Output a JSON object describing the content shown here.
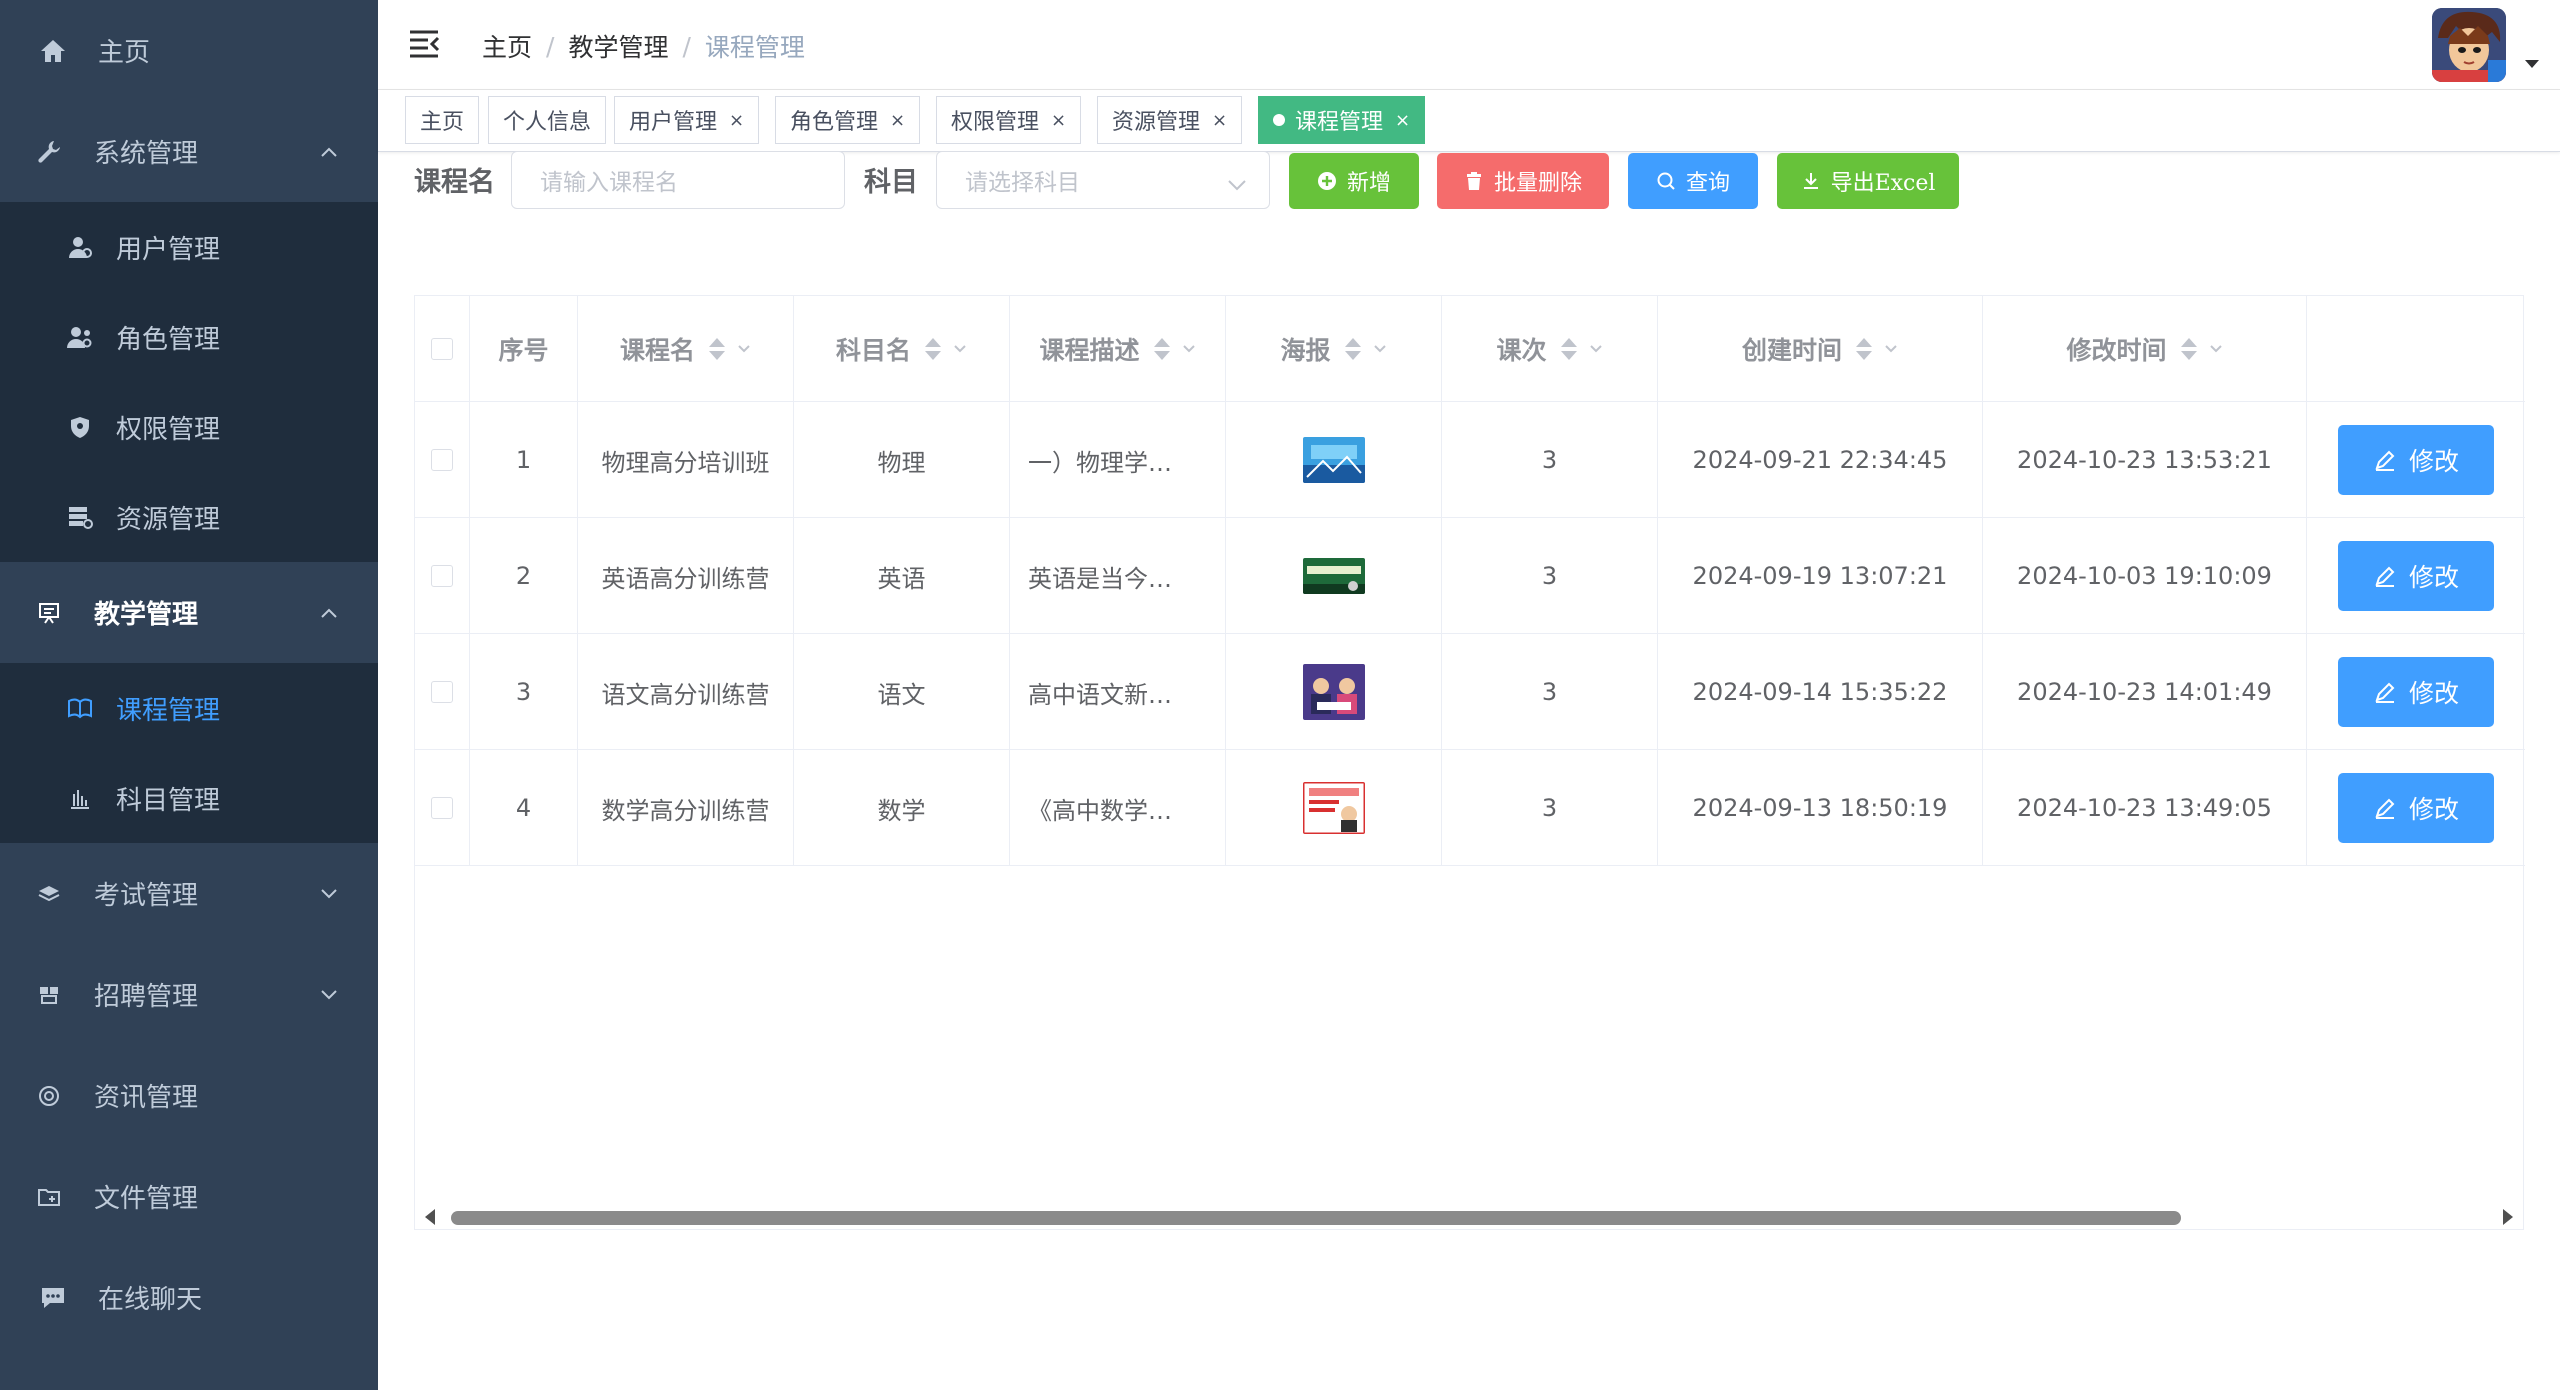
{
  "sidebar": {
    "items": [
      {
        "label": "主页",
        "icon": "home-icon"
      },
      {
        "label": "系统管理",
        "icon": "wrench-icon",
        "expanded": true
      },
      {
        "label": "教学管理",
        "icon": "teaching-icon",
        "expanded": true
      },
      {
        "label": "考试管理",
        "icon": "exam-icon",
        "expanded": false
      },
      {
        "label": "招聘管理",
        "icon": "recruit-icon",
        "expanded": false
      },
      {
        "label": "资讯管理",
        "icon": "news-icon"
      },
      {
        "label": "文件管理",
        "icon": "folder-icon"
      },
      {
        "label": "在线聊天",
        "icon": "chat-icon"
      }
    ],
    "system_sub": [
      {
        "label": "用户管理",
        "icon": "user-icon"
      },
      {
        "label": "角色管理",
        "icon": "role-icon"
      },
      {
        "label": "权限管理",
        "icon": "shield-icon"
      },
      {
        "label": "资源管理",
        "icon": "resource-icon"
      }
    ],
    "teaching_sub": [
      {
        "label": "课程管理",
        "icon": "book-icon",
        "active": true
      },
      {
        "label": "科目管理",
        "icon": "subject-icon"
      }
    ]
  },
  "breadcrumb": [
    "主页",
    "教学管理",
    "课程管理"
  ],
  "tags": [
    {
      "label": "主页",
      "closable": false
    },
    {
      "label": "个人信息",
      "closable": false
    },
    {
      "label": "用户管理",
      "closable": true
    },
    {
      "label": "角色管理",
      "closable": true
    },
    {
      "label": "权限管理",
      "closable": true
    },
    {
      "label": "资源管理",
      "closable": true
    },
    {
      "label": "课程管理",
      "closable": true,
      "active": true
    }
  ],
  "tag_close_glyph": "×",
  "search": {
    "course_label": "课程名",
    "course_placeholder": "请输入课程名",
    "subject_label": "科目",
    "subject_placeholder": "请选择科目"
  },
  "buttons": {
    "add": "新增",
    "batch_delete": "批量删除",
    "query": "查询",
    "export": "导出Excel",
    "edit": "修改"
  },
  "table": {
    "columns": [
      "序号",
      "课程名",
      "科目名",
      "课程描述",
      "海报",
      "课次",
      "创建时间",
      "修改时间"
    ],
    "rows": [
      {
        "index": "1",
        "name": "物理高分培训班",
        "subject": "物理",
        "desc": "一）物理学…",
        "count": "3",
        "created": "2024-09-21 22:34:45",
        "modified": "2024-10-23 13:53:21"
      },
      {
        "index": "2",
        "name": "英语高分训练营",
        "subject": "英语",
        "desc": "英语是当今…",
        "count": "3",
        "created": "2024-09-19 13:07:21",
        "modified": "2024-10-03 19:10:09"
      },
      {
        "index": "3",
        "name": "语文高分训练营",
        "subject": "语文",
        "desc": "高中语文新…",
        "count": "3",
        "created": "2024-09-14 15:35:22",
        "modified": "2024-10-23 14:01:49"
      },
      {
        "index": "4",
        "name": "数学高分训练营",
        "subject": "数学",
        "desc": "《高中数学…",
        "count": "3",
        "created": "2024-09-13 18:50:19",
        "modified": "2024-10-23 13:49:05"
      }
    ]
  },
  "colors": {
    "sidebar_bg": "#304156",
    "submenu_bg": "#1f2d3d",
    "active_blue": "#409eff",
    "tag_active": "#42b983",
    "success": "#67c23a",
    "danger": "#f56c6c"
  }
}
